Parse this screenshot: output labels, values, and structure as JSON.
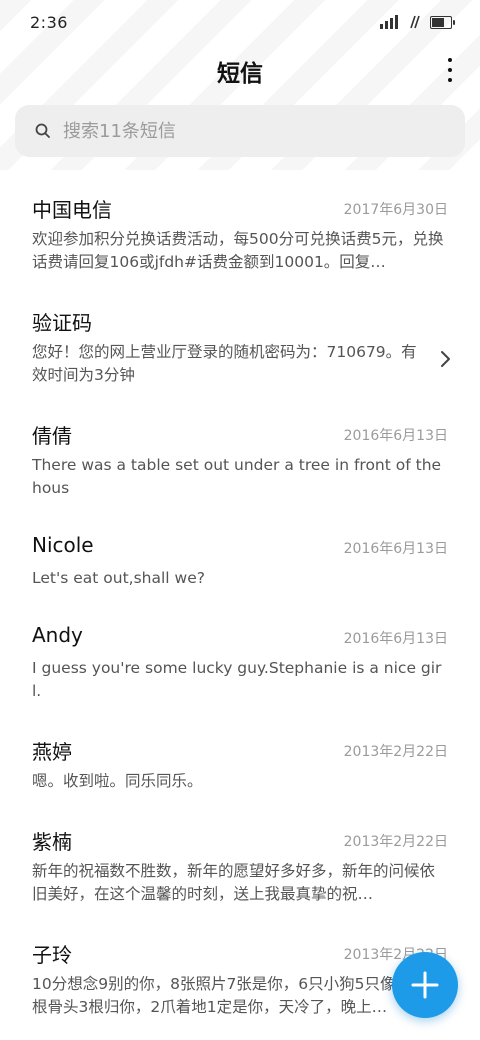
{
  "status_bar": {
    "time": "2:36"
  },
  "header": {
    "title": "短信"
  },
  "search": {
    "placeholder": "搜索11条短信"
  },
  "messages": [
    {
      "name": "中国电信",
      "date": "2017年6月30日",
      "preview": "欢迎参加积分兑换话费活动，每500分可兑换话费5元，兑换话费请回复106或jfdh#话费金额到10001。回复…"
    },
    {
      "name": "验证码",
      "date": "",
      "preview": "您好！您的网上营业厅登录的随机密码为：710679。有效时间为3分钟"
    },
    {
      "name": "倩倩",
      "date": "2016年6月13日",
      "preview": "There was a table set out under a tree in front of the hous"
    },
    {
      "name": "Nicole",
      "date": "2016年6月13日",
      "preview": "Let's eat out,shall we?"
    },
    {
      "name": "Andy",
      "date": "2016年6月13日",
      "preview": "I guess you're some lucky guy.Stephanie is a nice girl."
    },
    {
      "name": "燕婷",
      "date": "2013年2月22日",
      "preview": "嗯。收到啦。同乐同乐。"
    },
    {
      "name": "紫楠",
      "date": "2013年2月22日",
      "preview": "新年的祝福数不胜数，新年的愿望好多好多，新年的问候依旧美好，在这个温馨的时刻，送上我最真挚的祝…"
    },
    {
      "name": "子玲",
      "date": "2013年2月22日",
      "preview": "10分想念9别的你，8张照片7张是你，6只小狗5只像你，4根骨头3根归你，2爪着地1定是你，天冷了，晚上…"
    }
  ],
  "icons": {
    "search": "search-icon",
    "more": "more-vertical-icon",
    "chevron": "chevron-right-icon",
    "compose": "plus-icon"
  },
  "colors": {
    "accent": "#1e9be8",
    "search_bg": "#eeeeef",
    "secondary_text": "#9b9b9b"
  }
}
